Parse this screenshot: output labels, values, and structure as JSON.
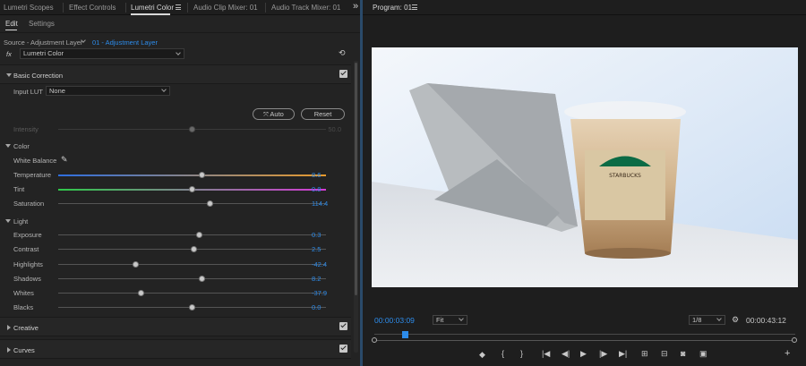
{
  "tabs": [
    {
      "label": "Lumetri Scopes"
    },
    {
      "label": "Effect Controls"
    },
    {
      "label": "Lumetri Color"
    },
    {
      "label": "Audio Clip Mixer: 01"
    },
    {
      "label": "Audio Track Mixer: 01"
    }
  ],
  "overflow_label": "»",
  "subtabs": {
    "edit": "Edit",
    "settings": "Settings"
  },
  "source": {
    "label": "Source - Adjustment Layer",
    "sequence": "01 - Adjustment Layer"
  },
  "fx": {
    "badge": "fx",
    "effect": "Lumetri Color"
  },
  "basic": {
    "title": "Basic Correction",
    "input_lut_label": "Input LUT",
    "input_lut_value": "None",
    "auto_label": "Auto",
    "reset_label": "Reset",
    "intensity": {
      "label": "Intensity",
      "value": "50.0",
      "level": 0.5
    }
  },
  "color": {
    "title": "Color",
    "white_balance_label": "White Balance",
    "sliders": [
      {
        "label": "Temperature",
        "value": "8.6",
        "level": 0.54
      },
      {
        "label": "Tint",
        "value": "0.8",
        "level": 0.5
      },
      {
        "label": "Saturation",
        "value": "114.4",
        "level": 0.57
      }
    ]
  },
  "light": {
    "title": "Light",
    "sliders": [
      {
        "label": "Exposure",
        "value": "0.3",
        "level": 0.53
      },
      {
        "label": "Contrast",
        "value": "2.5",
        "level": 0.51
      },
      {
        "label": "Highlights",
        "value": "-42.4",
        "level": 0.29
      },
      {
        "label": "Shadows",
        "value": "8.2",
        "level": 0.54
      },
      {
        "label": "Whites",
        "value": "-37.9",
        "level": 0.31
      },
      {
        "label": "Blacks",
        "value": "0.0",
        "level": 0.5
      }
    ]
  },
  "creative": {
    "title": "Creative"
  },
  "curves": {
    "title": "Curves"
  },
  "program": {
    "title": "Program: 01",
    "timecode": "00:00:03:09",
    "fit": "Fit",
    "resolution": "1/8",
    "duration": "00:00:43:12",
    "cup_brand": "STARBUCKS",
    "playhead_fraction": 0.073
  },
  "colors": {
    "accent": "#2d8ceb",
    "temperature_left": "#2d6ee0",
    "temperature_right": "#e89a2c",
    "tint_left": "#2fc94a",
    "tint_right": "#d43ad6"
  }
}
